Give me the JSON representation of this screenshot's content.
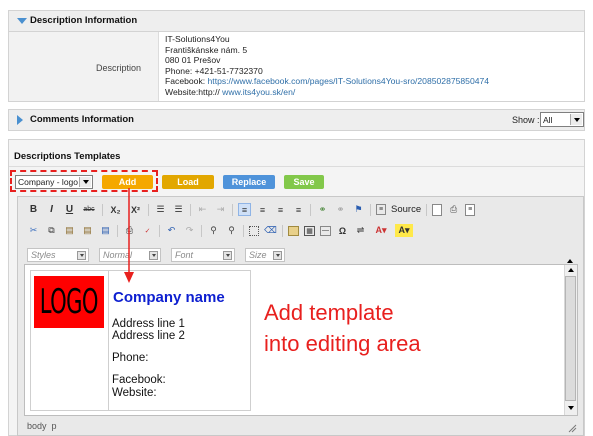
{
  "description_section": {
    "title": "Description Information",
    "label": "Description",
    "lines": [
      "IT-Solutions4You",
      "Františkánske nám. 5",
      "080 01 Prešov",
      "Phone: +421-51-7732370"
    ],
    "facebook_label": "Facebook:",
    "facebook_url": "https://www.facebook.com/pages/IT-Solutions4You-sro/208502875850474",
    "website_label": "Website:http://",
    "website_url": "www.its4you.sk/en/"
  },
  "comments_section": {
    "title": "Comments Information",
    "show_label": "Show :",
    "show_value": "All"
  },
  "templates_section": {
    "title": "Descriptions Templates",
    "template_select": "Company - logo",
    "buttons": {
      "add": "Add",
      "load": "Load",
      "replace": "Replace",
      "save": "Save"
    }
  },
  "editor": {
    "toolbar1": {
      "bold": "B",
      "italic": "I",
      "underline": "U",
      "strike": "abc",
      "subscript": "X₂",
      "superscript": "X²",
      "source": "Source"
    },
    "combos": {
      "styles": "Styles",
      "format": "Normal",
      "font": "Font",
      "size": "Size"
    },
    "content": {
      "logo": "LOGO",
      "company": "Company name",
      "address1": "Address line 1",
      "address2": "Address line 2",
      "phone": "Phone:",
      "facebook": "Facebook:",
      "website": "Website:"
    },
    "status_path": "body  p"
  },
  "annotation": {
    "line1": "Add template",
    "line2": "into editing area"
  },
  "colors": {
    "add": "#f5a800",
    "load": "#e2a700",
    "replace": "#4f93da",
    "save": "#82c84a",
    "annotation": "#e8201e",
    "company": "#0d1fd0",
    "logo_bg": "#ff0000"
  }
}
